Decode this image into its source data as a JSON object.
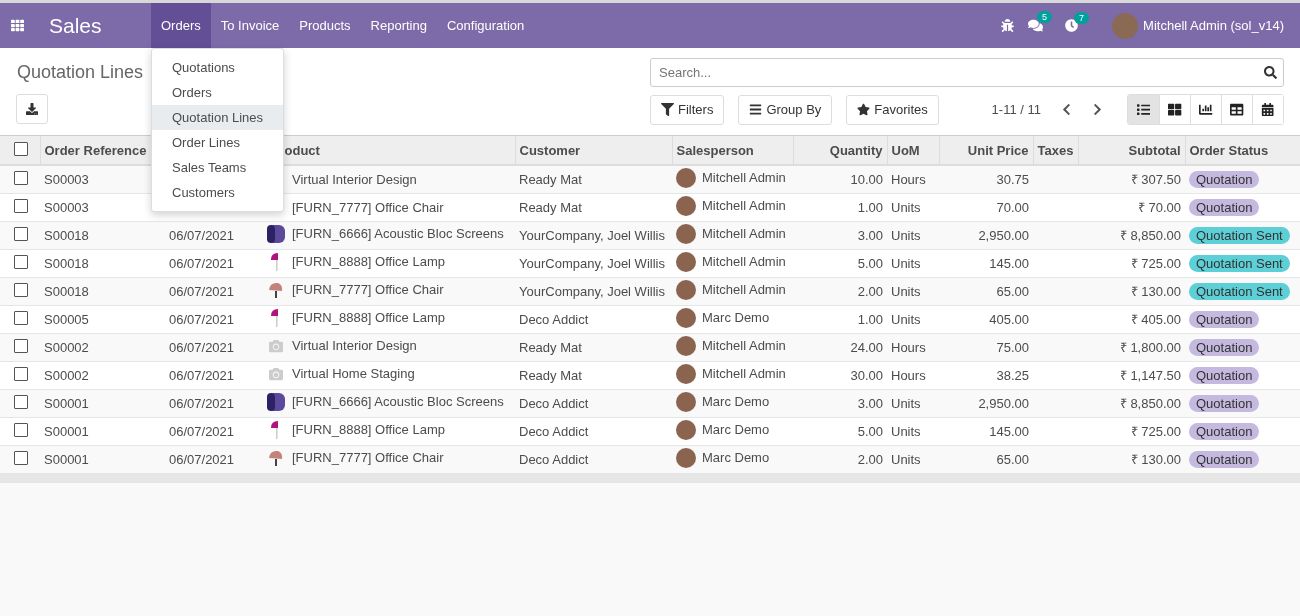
{
  "navbar": {
    "brand": "Sales",
    "menu": [
      {
        "label": "Orders",
        "selected": true
      },
      {
        "label": "To Invoice",
        "selected": false
      },
      {
        "label": "Products",
        "selected": false
      },
      {
        "label": "Reporting",
        "selected": false
      },
      {
        "label": "Configuration",
        "selected": false
      }
    ],
    "messages_badge": "5",
    "activities_badge": "7",
    "user": "Mitchell Admin (sol_v14)"
  },
  "dropdown": [
    {
      "label": "Quotations",
      "selected": false
    },
    {
      "label": "Orders",
      "selected": false
    },
    {
      "label": "Quotation Lines",
      "selected": true
    },
    {
      "label": "Order Lines",
      "selected": false
    },
    {
      "label": "Sales Teams",
      "selected": false
    },
    {
      "label": "Customers",
      "selected": false
    }
  ],
  "control_panel": {
    "title": "Quotation Lines",
    "search": {
      "placeholder": "Search..."
    },
    "filters": [
      "Filters",
      "Group By",
      "Favorites"
    ],
    "pager": "1-11 / 11",
    "views": [
      {
        "kind": "list",
        "selected": true
      },
      {
        "kind": "kanban",
        "selected": false
      },
      {
        "kind": "graph",
        "selected": false
      },
      {
        "kind": "pivot",
        "selected": false
      },
      {
        "kind": "calendar",
        "selected": false
      }
    ]
  },
  "table": {
    "select_all": {
      "checked": false
    },
    "columns": [
      "Order Reference",
      "oduct",
      "Customer",
      "Salesperson",
      "Quantity",
      "UoM",
      "Unit Price",
      "Taxes",
      "Subtotal",
      "Order Status"
    ],
    "rows": [
      {
        "checked": false,
        "ref": "S00003",
        "product": "Virtual Interior Design",
        "customer": "Ready Mat",
        "salesperson": "Mitchell Admin",
        "quantity": "10.00",
        "uom": "Hours",
        "unit_price": "30.75",
        "subtotal": "₹ 307.50",
        "status": "Quotation",
        "color": "#c5b9df"
      },
      {
        "checked": false,
        "ref": "S00003",
        "product": "[FURN_7777] Office Chair",
        "customer": "Ready Mat",
        "salesperson": "Mitchell Admin",
        "quantity": "1.00",
        "uom": "Units",
        "unit_price": "70.00",
        "subtotal": "₹ 70.00",
        "status": "Quotation",
        "color": "#c5b9df"
      },
      {
        "checked": false,
        "ref": "S00018",
        "date": "06/07/2021",
        "kind": "screen",
        "product": "[FURN_6666] Acoustic Bloc Screens",
        "customer": "YourCompany, Joel Willis",
        "salesperson": "Mitchell Admin",
        "quantity": "3.00",
        "uom": "Units",
        "unit_price": "2,950.00",
        "subtotal": "₹ 8,850.00",
        "status": "Quotation Sent",
        "color": "#5ccfd7"
      },
      {
        "checked": false,
        "ref": "S00018",
        "date": "06/07/2021",
        "kind": "lamp",
        "product": "[FURN_8888] Office Lamp",
        "customer": "YourCompany, Joel Willis",
        "salesperson": "Mitchell Admin",
        "quantity": "5.00",
        "uom": "Units",
        "unit_price": "145.00",
        "subtotal": "₹ 725.00",
        "status": "Quotation Sent",
        "color": "#5ccfd7"
      },
      {
        "checked": false,
        "ref": "S00018",
        "date": "06/07/2021",
        "kind": "chair",
        "product": "[FURN_7777] Office Chair",
        "customer": "YourCompany, Joel Willis",
        "salesperson": "Mitchell Admin",
        "quantity": "2.00",
        "uom": "Units",
        "unit_price": "65.00",
        "subtotal": "₹ 130.00",
        "status": "Quotation Sent",
        "color": "#5ccfd7"
      },
      {
        "checked": false,
        "ref": "S00005",
        "date": "06/07/2021",
        "kind": "lamp",
        "product": "[FURN_8888] Office Lamp",
        "customer": "Deco Addict",
        "salesperson": "Marc Demo",
        "quantity": "1.00",
        "uom": "Units",
        "unit_price": "405.00",
        "subtotal": "₹ 405.00",
        "status": "Quotation",
        "color": "#c5b9df"
      },
      {
        "checked": false,
        "ref": "S00002",
        "date": "06/07/2021",
        "kind": "camera",
        "product": "Virtual Interior Design",
        "customer": "Ready Mat",
        "salesperson": "Mitchell Admin",
        "quantity": "24.00",
        "uom": "Hours",
        "unit_price": "75.00",
        "subtotal": "₹ 1,800.00",
        "status": "Quotation",
        "color": "#c5b9df"
      },
      {
        "checked": false,
        "ref": "S00002",
        "date": "06/07/2021",
        "kind": "camera",
        "product": "Virtual Home Staging",
        "customer": "Ready Mat",
        "salesperson": "Mitchell Admin",
        "quantity": "30.00",
        "uom": "Hours",
        "unit_price": "38.25",
        "subtotal": "₹ 1,147.50",
        "status": "Quotation",
        "color": "#c5b9df"
      },
      {
        "checked": false,
        "ref": "S00001",
        "date": "06/07/2021",
        "kind": "screen",
        "product": "[FURN_6666] Acoustic Bloc Screens",
        "customer": "Deco Addict",
        "salesperson": "Marc Demo",
        "quantity": "3.00",
        "uom": "Units",
        "unit_price": "2,950.00",
        "subtotal": "₹ 8,850.00",
        "status": "Quotation",
        "color": "#c5b9df"
      },
      {
        "checked": false,
        "ref": "S00001",
        "date": "06/07/2021",
        "kind": "lamp",
        "product": "[FURN_8888] Office Lamp",
        "customer": "Deco Addict",
        "salesperson": "Marc Demo",
        "quantity": "5.00",
        "uom": "Units",
        "unit_price": "145.00",
        "subtotal": "₹ 725.00",
        "status": "Quotation",
        "color": "#c5b9df"
      },
      {
        "checked": false,
        "ref": "S00001",
        "date": "06/07/2021",
        "kind": "chair",
        "product": "[FURN_7777] Office Chair",
        "customer": "Deco Addict",
        "salesperson": "Marc Demo",
        "quantity": "2.00",
        "uom": "Units",
        "unit_price": "65.00",
        "subtotal": "₹ 130.00",
        "status": "Quotation",
        "color": "#c5b9df"
      }
    ]
  }
}
